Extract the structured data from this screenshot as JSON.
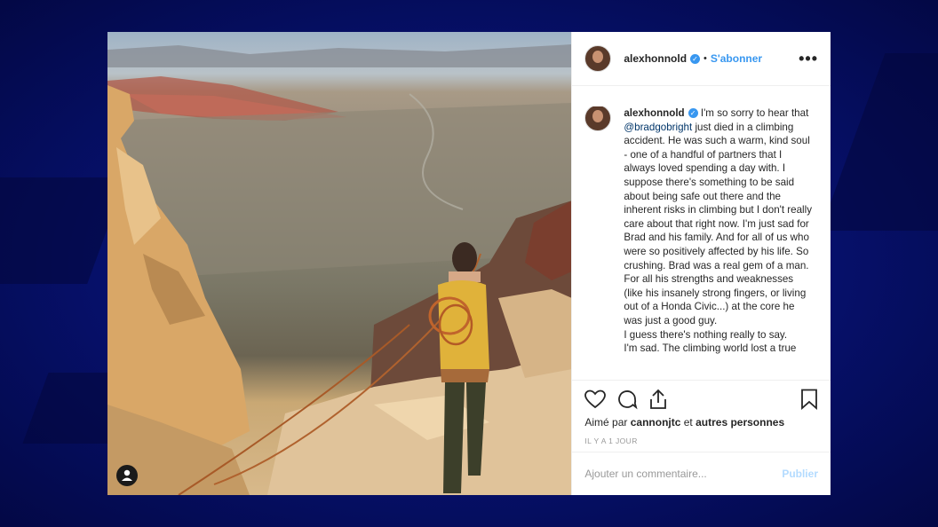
{
  "post": {
    "username": "alexhonnold",
    "follow_label": "S'abonner",
    "more_label": "•••",
    "caption_mention": "@bradgobright",
    "caption_part1": "I'm so sorry to hear that",
    "caption_part2": "just died in a climbing accident. He was such a warm, kind soul - one of a handful of partners that I always loved spending a day with. I suppose there's something to be said about being safe out there and the inherent risks in climbing but I don't really care about that right now. I'm just sad for Brad and his family. And for all of us who were so positively affected by his life. So crushing. Brad was a real gem of a man. For all his strengths and weaknesses (like his insanely strong fingers, or living out of a Honda Civic...) at the core he was just a good guy.",
    "caption_part3": "I guess there's nothing really to say.",
    "caption_part4": "I'm sad. The climbing world lost a true",
    "likes_prefix": "Aimé par",
    "likes_user": "cannonjtc",
    "likes_conj": "et",
    "likes_others": "autres personnes",
    "timestamp": "IL Y A 1 JOUR",
    "comment_placeholder": "Ajouter un commentaire...",
    "publish_label": "Publier"
  },
  "icons": [
    "heart-icon",
    "comment-icon",
    "share-icon",
    "bookmark-icon",
    "user-tag-icon",
    "verified-icon"
  ],
  "colors": {
    "accent": "#3897f0",
    "background": "#06106a",
    "publish_disabled": "#b3dbff"
  }
}
